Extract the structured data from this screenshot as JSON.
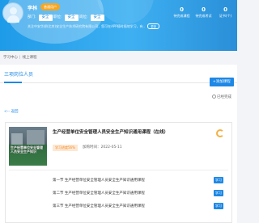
{
  "header": {
    "user_name": "李林",
    "badge": "普通用户",
    "fields": [
      {
        "label": "部门:",
        "value": "安全"
      },
      {
        "label": "职位:",
        "value": "安全"
      },
      {
        "label": "岗位:",
        "value": "安全"
      }
    ],
    "notice": "关注中安华邦(北京)安全生产技术研究院有限公司，您可在APP随时随地学习，有..",
    "notice_more": "更多",
    "stats": [
      {
        "value": "0",
        "label": "待完成课程"
      },
      {
        "value": "0",
        "label": "待完成考试"
      },
      {
        "value": "0",
        "label": "证书(个)"
      }
    ]
  },
  "breadcrumb": {
    "home": "学习中心",
    "current": "线上课程"
  },
  "tabs": [
    {
      "label": "三项岗位人员"
    }
  ],
  "add_button": "+添加课程",
  "retake_label": "已经完成",
  "back_link": "<-- 返回",
  "course": {
    "thumb_text": "生产经营单位安全管理人员安全生产知识",
    "title": "生产经营单位安全管理人员安全生产知识通用课程（在线）",
    "progress": "学习进度56%",
    "date": "加购时间：2022-05-11",
    "chapters": [
      {
        "title": "第一节 生产经营单位安全管理人员安全生产知识通用课程",
        "action": "学习"
      },
      {
        "title": "第二节 生产经营单位安全管理人员安全生产知识通用课程",
        "action": "学习"
      },
      {
        "title": "第三节 生产经营单位安全管理人员安全生产知识通用课程",
        "action": "学习"
      }
    ]
  },
  "colors": {
    "primary": "#1e88e5",
    "header": "#2aa3ee",
    "progress": "#f08a24",
    "badge": "#f5a623"
  }
}
